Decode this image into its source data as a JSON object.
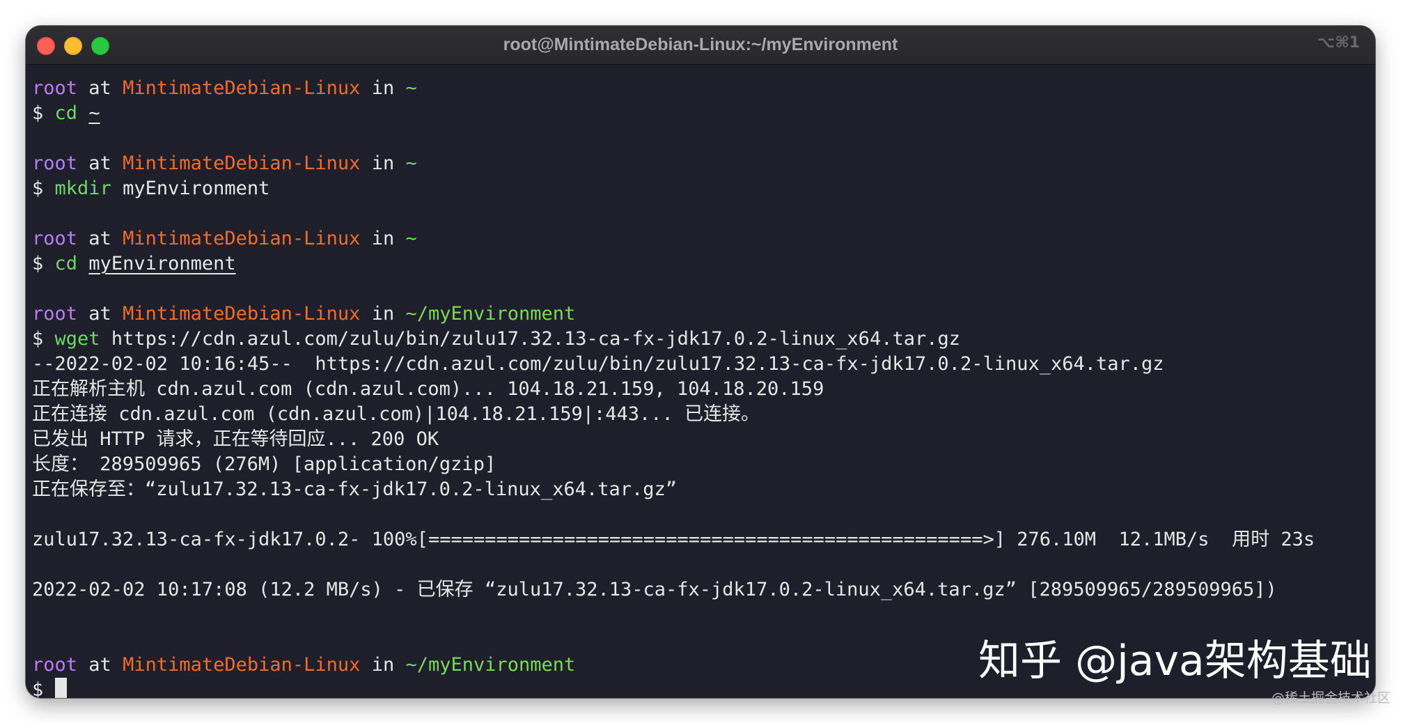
{
  "window": {
    "title": "root@MintimateDebian-Linux:~/myEnvironment",
    "shortcut": "⌥⌘1"
  },
  "prompt": {
    "user": "root",
    "at": " at ",
    "host": "MintimateDebian-Linux",
    "in": " in "
  },
  "blocks": [
    {
      "path": "~",
      "cmd": "cd",
      "arg": "~"
    },
    {
      "path": "~",
      "cmd": "mkdir",
      "arg": "myEnvironment"
    },
    {
      "path": "~",
      "cmd": "cd",
      "arg": "myEnvironment"
    },
    {
      "path": "~/myEnvironment",
      "cmd": "wget",
      "arg": "https://cdn.azul.com/zulu/bin/zulu17.32.13-ca-fx-jdk17.0.2-linux_x64.tar.gz"
    }
  ],
  "output": [
    "--2022-02-02 10:16:45--  https://cdn.azul.com/zulu/bin/zulu17.32.13-ca-fx-jdk17.0.2-linux_x64.tar.gz",
    "正在解析主机 cdn.azul.com (cdn.azul.com)... 104.18.21.159, 104.18.20.159",
    "正在连接 cdn.azul.com (cdn.azul.com)|104.18.21.159|:443... 已连接。",
    "已发出 HTTP 请求，正在等待回应... 200 OK",
    "长度： 289509965 (276M) [application/gzip]",
    "正在保存至：“zulu17.32.13-ca-fx-jdk17.0.2-linux_x64.tar.gz”",
    "zulu17.32.13-ca-fx-jdk17.0.2- 100%[=================================================>] 276.10M  12.1MB/s  用时 23s",
    "2022-02-02 10:17:08 (12.2 MB/s) - 已保存 “zulu17.32.13-ca-fx-jdk17.0.2-linux_x64.tar.gz” [289509965/289509965])"
  ],
  "final": {
    "path": "~/myEnvironment",
    "symbol": "$"
  },
  "dollar": "$",
  "watermark": "知乎 @java架构基础",
  "credit": "@稀土掘金技术社区"
}
